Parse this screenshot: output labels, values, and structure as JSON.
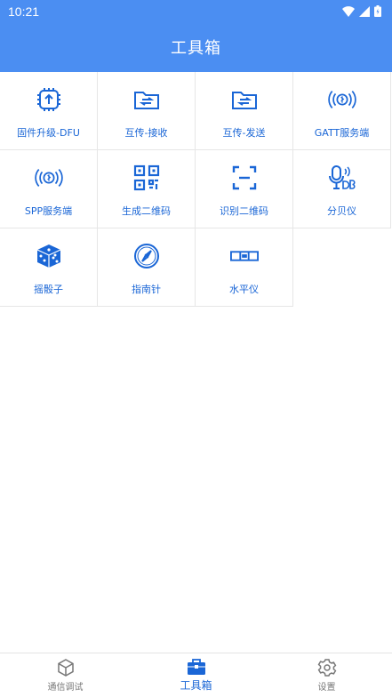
{
  "status_bar": {
    "time": "10:21"
  },
  "app_bar": {
    "title": "工具箱"
  },
  "tools": [
    {
      "label": "固件升级-DFU",
      "icon": "chip-upload-icon"
    },
    {
      "label": "互传-接收",
      "icon": "folder-receive-icon"
    },
    {
      "label": "互传-发送",
      "icon": "folder-send-icon"
    },
    {
      "label": "GATT服务端",
      "icon": "ble-server-icon"
    },
    {
      "label": "SPP服务端",
      "icon": "spp-server-icon"
    },
    {
      "label": "生成二维码",
      "icon": "qrcode-icon"
    },
    {
      "label": "识别二维码",
      "icon": "scan-qrcode-icon"
    },
    {
      "label": "分贝仪",
      "icon": "decibel-meter-icon"
    },
    {
      "label": "摇骰子",
      "icon": "dice-icon"
    },
    {
      "label": "指南针",
      "icon": "compass-icon"
    },
    {
      "label": "水平仪",
      "icon": "level-icon"
    }
  ],
  "bottom_nav": {
    "items": [
      {
        "label": "通信调试",
        "icon": "cube-icon",
        "active": false
      },
      {
        "label": "工具箱",
        "icon": "toolbox-icon",
        "active": true
      },
      {
        "label": "设置",
        "icon": "gear-icon",
        "active": false
      }
    ]
  },
  "colors": {
    "primary": "#4b8ef2",
    "accent_text": "#1a66d6",
    "inactive": "#777777"
  }
}
